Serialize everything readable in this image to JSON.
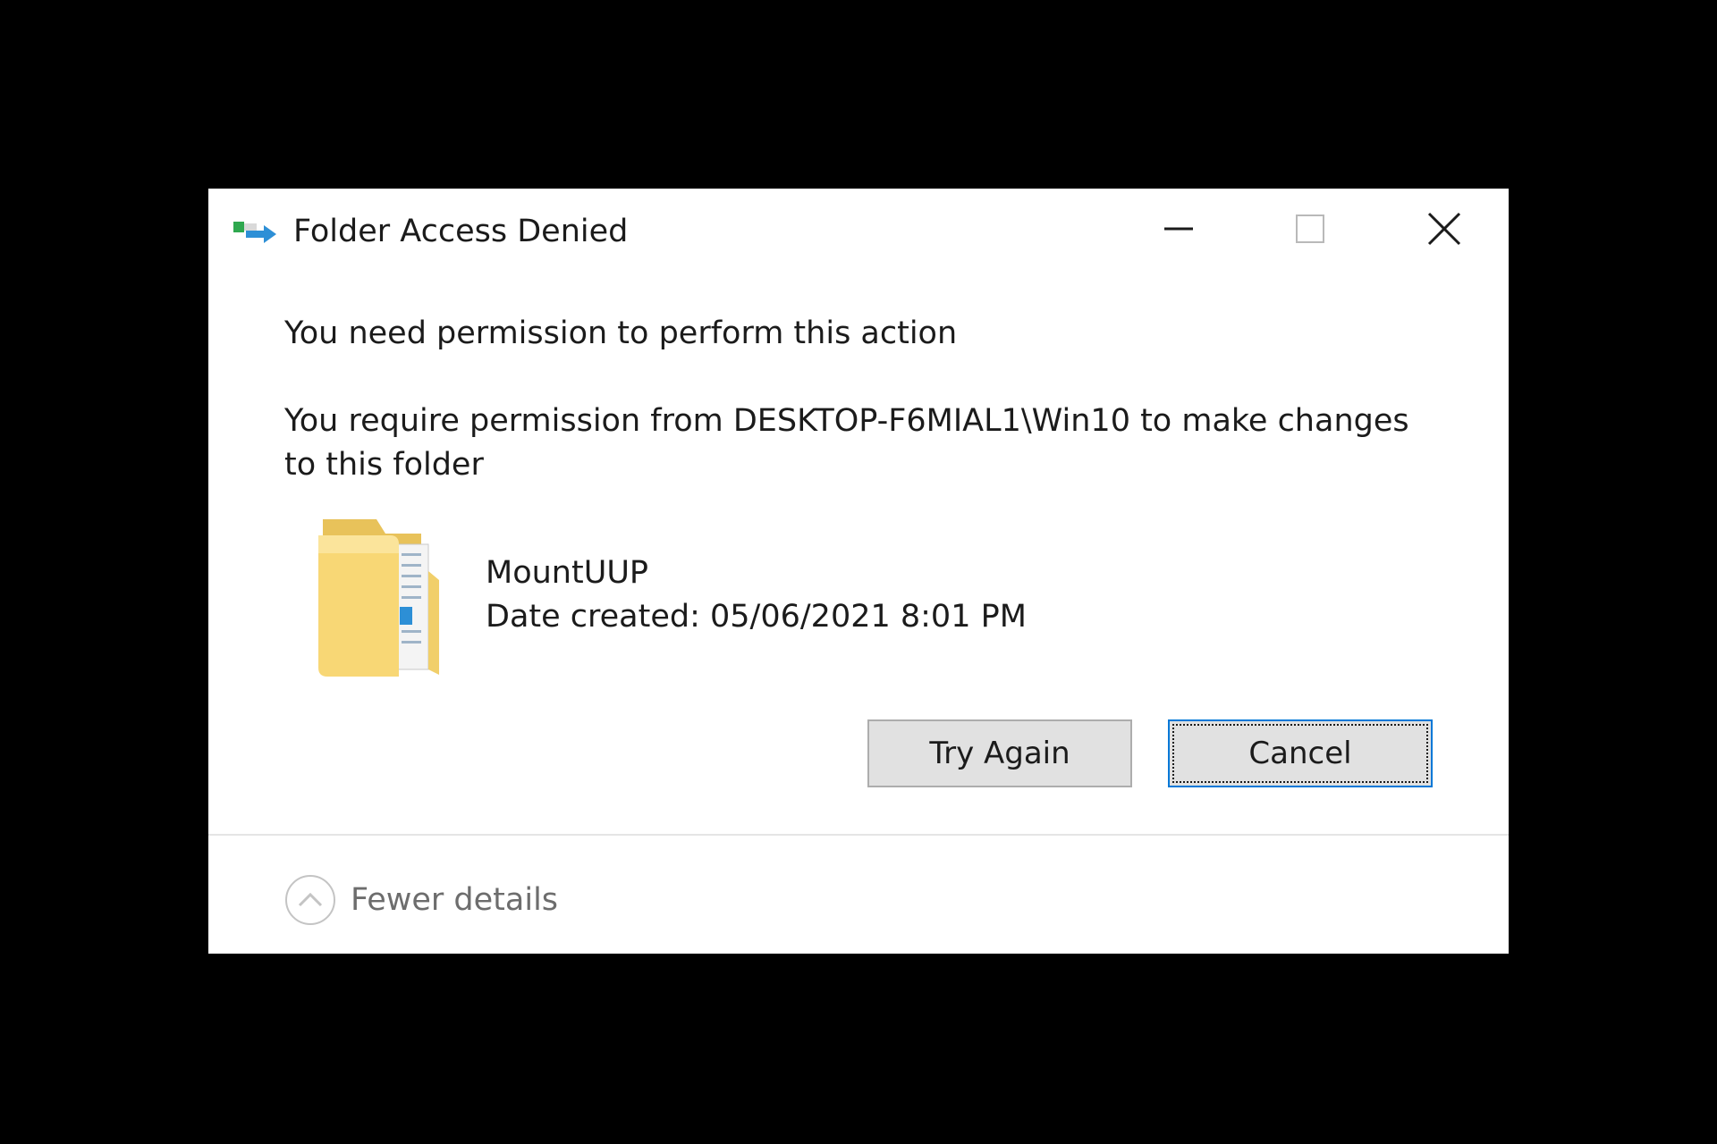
{
  "window": {
    "title": "Folder Access Denied",
    "icon": "folder-move-icon"
  },
  "window_controls": {
    "minimize_icon": "minimize-icon",
    "maximize_icon": "maximize-icon",
    "close_icon": "close-icon"
  },
  "message": {
    "main": "You need permission to perform this action",
    "detail": "You require permission from DESKTOP-F6MIAL1\\Win10 to make changes to this folder"
  },
  "item": {
    "icon": "folder-icon",
    "name": "MountUUP",
    "date_created": "Date created: 05/06/2021 8:01 PM"
  },
  "buttons": {
    "try_again": "Try Again",
    "cancel": "Cancel"
  },
  "footer": {
    "toggle_label": "Fewer details",
    "toggle_icon": "chevron-up-icon"
  },
  "colors": {
    "background": "#000000",
    "dialog": "#ffffff",
    "button_face": "#e1e1e1",
    "focus_border": "#0078d7",
    "muted_text": "#6d6d6d"
  }
}
